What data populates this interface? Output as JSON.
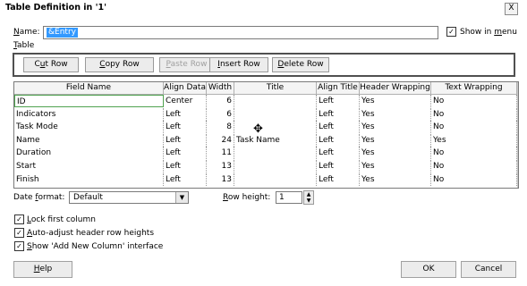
{
  "window": {
    "title": "Table Definition in '1'",
    "close_label": "X"
  },
  "name_row": {
    "label_underlined": "N",
    "label_rest": "ame:",
    "value": "&Entry",
    "show_in_menu_checked": true,
    "show_in_menu_pre": "Show in ",
    "show_in_menu_u": "m",
    "show_in_menu_post": "enu"
  },
  "table_section": {
    "label_underlined": "T",
    "label_rest": "able"
  },
  "toolbar": {
    "cut_row": {
      "pre": "C",
      "u": "u",
      "post": "t Row"
    },
    "copy_row": {
      "pre": "",
      "u": "C",
      "post": "opy Row"
    },
    "paste_row": {
      "pre": "",
      "u": "P",
      "post": "aste Row"
    },
    "insert_row": {
      "pre": "",
      "u": "I",
      "post": "nsert Row"
    },
    "delete_row": {
      "pre": "",
      "u": "D",
      "post": "elete Row"
    }
  },
  "grid": {
    "columns": [
      "Field Name",
      "Align Data",
      "Width",
      "Title",
      "Align Title",
      "Header Wrapping",
      "Text Wrapping"
    ],
    "rows": [
      {
        "field": "ID",
        "align": "Center",
        "width": "6",
        "title": "",
        "align_title": "Left",
        "header_wrap": "Yes",
        "text_wrap": "No"
      },
      {
        "field": "Indicators",
        "align": "Left",
        "width": "6",
        "title": "",
        "align_title": "Left",
        "header_wrap": "Yes",
        "text_wrap": "No"
      },
      {
        "field": "Task Mode",
        "align": "Left",
        "width": "8",
        "title": "",
        "align_title": "Left",
        "header_wrap": "Yes",
        "text_wrap": "No"
      },
      {
        "field": "Name",
        "align": "Left",
        "width": "24",
        "title": "Task Name",
        "align_title": "Left",
        "header_wrap": "Yes",
        "text_wrap": "Yes"
      },
      {
        "field": "Duration",
        "align": "Left",
        "width": "11",
        "title": "",
        "align_title": "Left",
        "header_wrap": "Yes",
        "text_wrap": "No"
      },
      {
        "field": "Start",
        "align": "Left",
        "width": "13",
        "title": "",
        "align_title": "Left",
        "header_wrap": "Yes",
        "text_wrap": "No"
      },
      {
        "field": "Finish",
        "align": "Left",
        "width": "13",
        "title": "",
        "align_title": "Left",
        "header_wrap": "Yes",
        "text_wrap": "No"
      }
    ]
  },
  "date_format": {
    "label_pre": "Date ",
    "label_u": "f",
    "label_post": "ormat:",
    "value": "Default"
  },
  "row_height": {
    "label_u": "R",
    "label_post": "ow height:",
    "value": "1"
  },
  "options": [
    {
      "u": "L",
      "post": "ock first column",
      "checked": true
    },
    {
      "u": "A",
      "post": "uto-adjust header row heights",
      "checked": true
    },
    {
      "u": "S",
      "post": "how 'Add New Column' interface",
      "checked": true
    }
  ],
  "buttons": {
    "help_u": "H",
    "help_post": "elp",
    "ok": "OK",
    "cancel": "Cancel"
  },
  "icons": {
    "close": "close-icon",
    "dropdown": "chevron-down-icon",
    "cursor": "pointer-cursor-icon"
  }
}
